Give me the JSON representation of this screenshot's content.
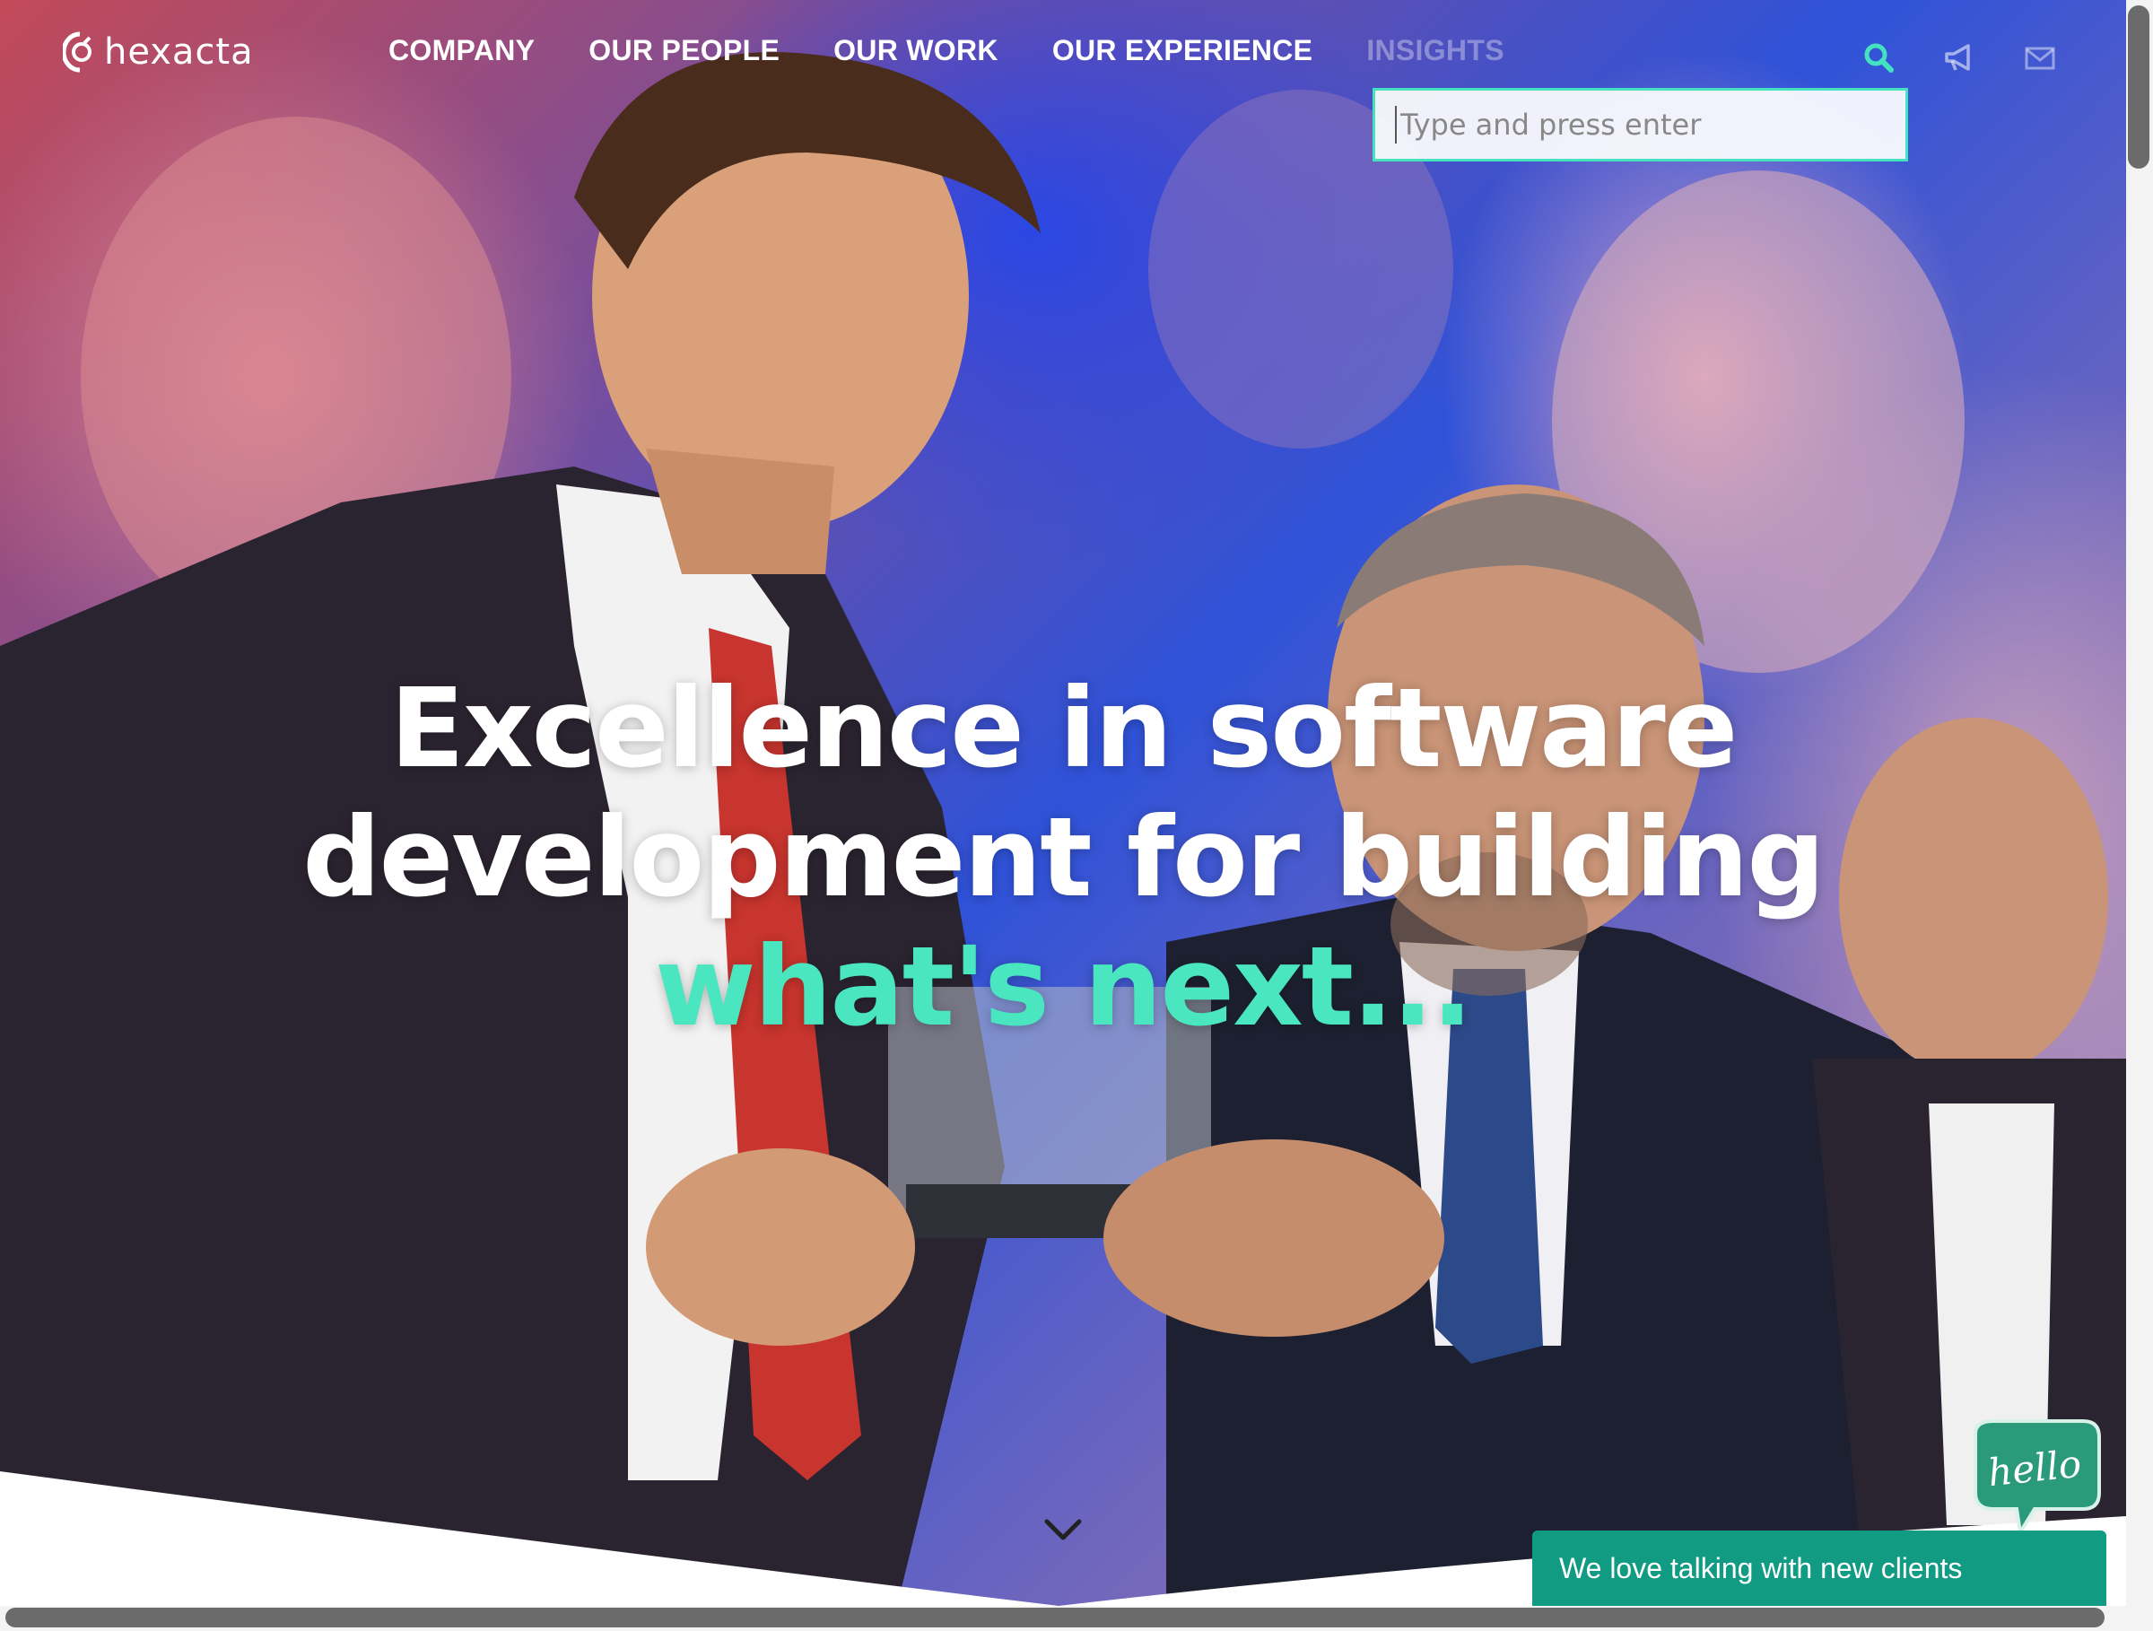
{
  "brand": {
    "name": "hexacta"
  },
  "nav": {
    "items": [
      {
        "label": "COMPANY"
      },
      {
        "label": "OUR PEOPLE"
      },
      {
        "label": "OUR WORK"
      },
      {
        "label": "OUR EXPERIENCE"
      },
      {
        "label": "INSIGHTS"
      }
    ],
    "icons": [
      "search-icon",
      "megaphone-icon",
      "envelope-icon"
    ]
  },
  "search": {
    "placeholder": "Type and press enter",
    "value": ""
  },
  "hero": {
    "line1": "Excellence in software",
    "line2": "development for building",
    "line3": "what's next...",
    "accent_color": "#49e6c0"
  },
  "chat": {
    "bubble_text": "hello",
    "bar_text": "We love talking with new clients",
    "color": "#119b82"
  },
  "colors": {
    "accent": "#45e2c0",
    "nav_text": "#ffffff"
  }
}
